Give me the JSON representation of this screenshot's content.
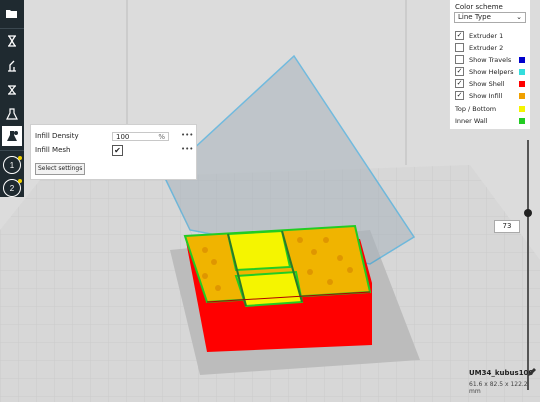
{
  "toolbar": {
    "tools": [
      {
        "name": "open-file-icon"
      },
      {
        "name": "move-tool-icon"
      },
      {
        "name": "scale-tool-icon"
      },
      {
        "name": "rotate-tool-icon"
      },
      {
        "name": "mirror-tool-icon"
      },
      {
        "name": "per-model-settings-icon",
        "active": true
      }
    ],
    "extruders": [
      "1",
      "2"
    ]
  },
  "infill_panel": {
    "density_label": "Infill Density",
    "density_value": "100",
    "density_unit": "%",
    "mesh_label": "Infill Mesh",
    "mesh_checked": "✔",
    "more": "•••",
    "select_button": "Select settings"
  },
  "color_panel": {
    "title": "Color scheme",
    "selected": "Line Type",
    "chevron": "⌄",
    "options": [
      {
        "label": "Extruder 1",
        "checked": "✓",
        "color": ""
      },
      {
        "label": "Extruder 2",
        "checked": "",
        "color": ""
      },
      {
        "label": "Show Travels",
        "checked": "",
        "color": "#0000cc"
      },
      {
        "label": "Show Helpers",
        "checked": "✓",
        "color": "#33dddd"
      },
      {
        "label": "Show Shell",
        "checked": "✓",
        "color": "#ff0000"
      },
      {
        "label": "Show Infill",
        "checked": "✓",
        "color": "#f0a000"
      }
    ],
    "legend": [
      {
        "label": "Top / Bottom",
        "color": "#f5f500"
      },
      {
        "label": "Inner Wall",
        "color": "#22cc22"
      }
    ]
  },
  "layer_slider": {
    "value": "73"
  },
  "model": {
    "name": "UM34_kubus100",
    "dimensions": "61.6 x 82.5 x 122.2 mm"
  },
  "colors": {
    "toolbar": "#1f2a30",
    "shell": "#ff0000",
    "infill": "#f0b400",
    "top_bottom": "#f5f500",
    "inner_wall": "#22cc22",
    "volume_outline": "#1aa0e0"
  }
}
